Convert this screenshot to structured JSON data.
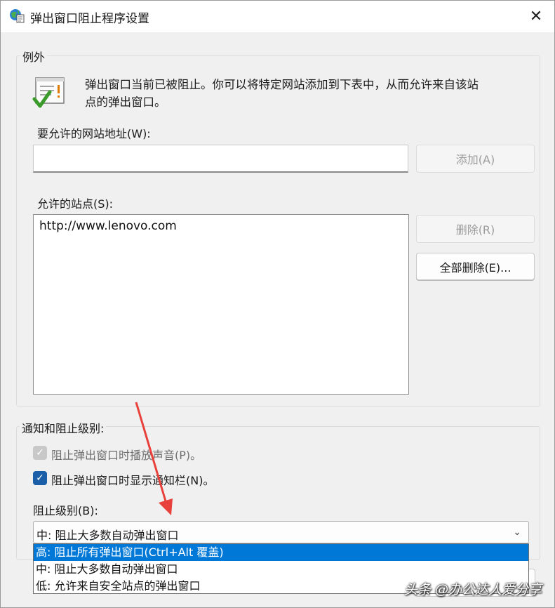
{
  "window": {
    "title": "弹出窗口阻止程序设置",
    "close_glyph": "✕"
  },
  "exceptions": {
    "group_label": "例外",
    "info_text_line1": "弹出窗口当前已被阻止。你可以将特定网站添加到下表中，从而允许来自该站",
    "info_text_line2": "点的弹出窗口。",
    "address_label": "要允许的网站地址(W):",
    "address_value": "",
    "add_button": "添加(A)",
    "allowed_label": "允许的站点(S):",
    "allowed_sites": [
      "http://www.lenovo.com"
    ],
    "remove_button": "删除(R)",
    "remove_all_button": "全部删除(E)..."
  },
  "notification": {
    "group_label": "通知和阻止级别:",
    "play_sound_label": "阻止弹出窗口时播放声音(P)。",
    "play_sound_checked": true,
    "show_bar_label": "阻止弹出窗口时显示通知栏(N)。",
    "show_bar_checked": true,
    "level_label": "阻止级别(B):",
    "level_selected": "中: 阻止大多数自动弹出窗口",
    "level_options": [
      "高: 阻止所有弹出窗口(Ctrl+Alt 覆盖)",
      "中: 阻止大多数自动弹出窗口",
      "低: 允许来自安全站点的弹出窗口"
    ]
  },
  "watermark": "头条 @办公达人爱分享",
  "colors": {
    "accent": "#0078d7",
    "checkbox": "#1b5fa8",
    "annotation_arrow": "#e8403a"
  },
  "icons": {
    "title": "globe-settings-icon",
    "info": "notepad-checkmark-icon",
    "close": "close-icon",
    "chevron": "chevron-down-icon"
  }
}
